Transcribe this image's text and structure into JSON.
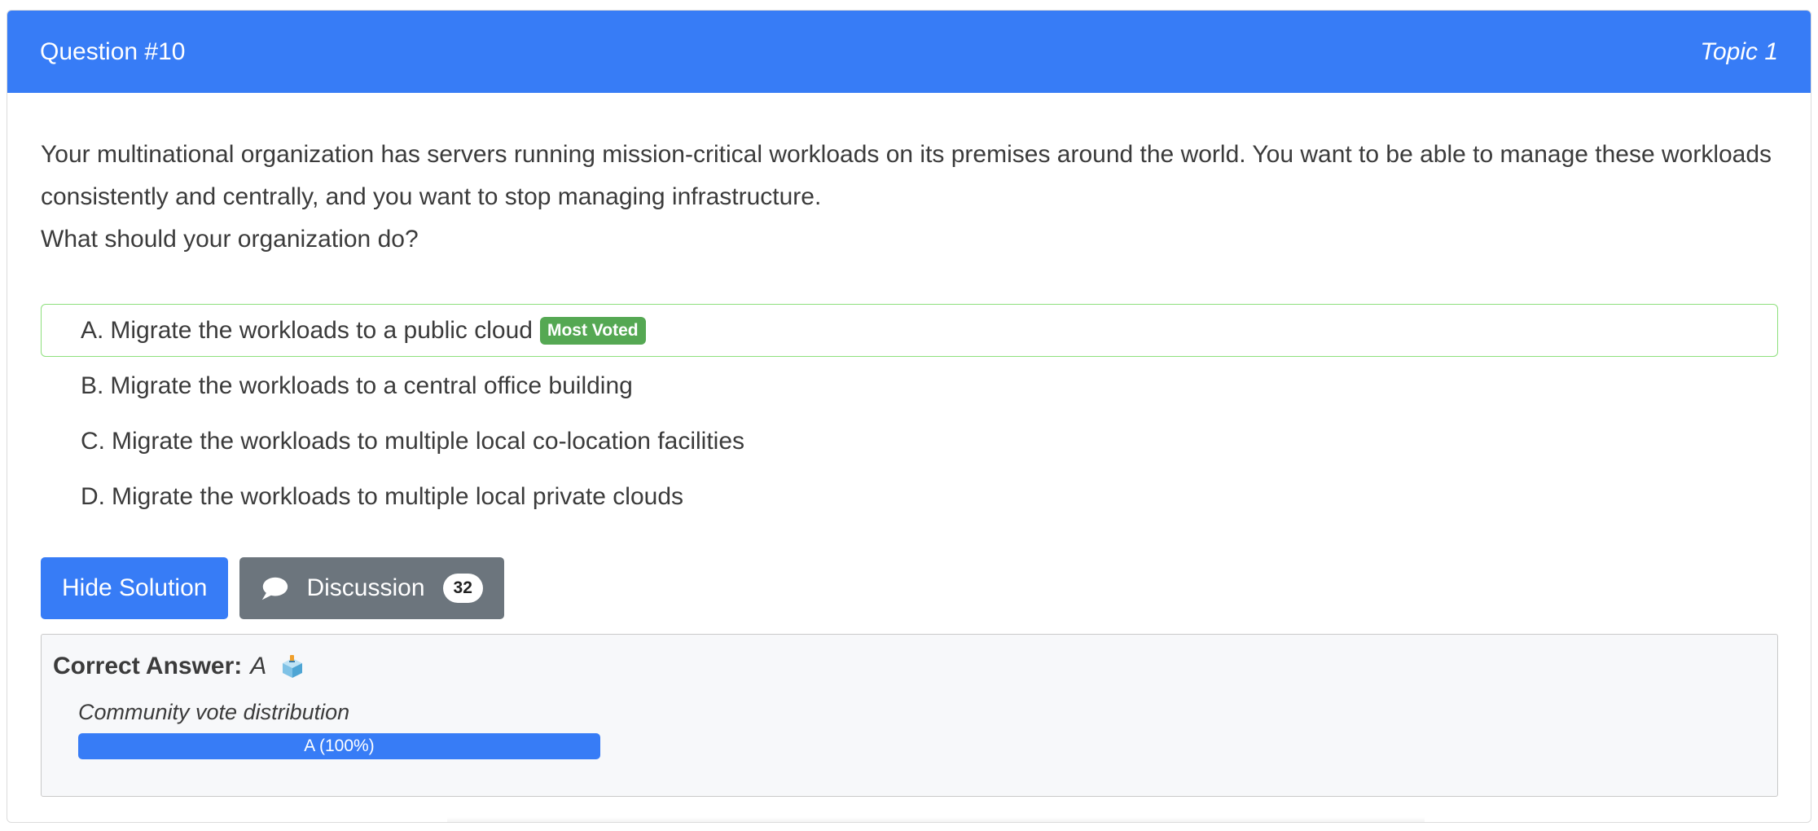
{
  "header": {
    "question_number": "Question #10",
    "topic": "Topic 1"
  },
  "question": {
    "line1": "Your multinational organization has servers running mission-critical workloads on its premises around the world. You want to be able to manage these workloads consistently and centrally, and you want to stop managing infrastructure.",
    "line2": "What should your organization do?"
  },
  "options": [
    {
      "letter": "A.",
      "text": "Migrate the workloads to a public cloud",
      "badge": "Most Voted"
    },
    {
      "letter": "B.",
      "text": "Migrate the workloads to a central office building"
    },
    {
      "letter": "C.",
      "text": "Migrate the workloads to multiple local co-location facilities"
    },
    {
      "letter": "D.",
      "text": "Migrate the workloads to multiple local private clouds"
    }
  ],
  "buttons": {
    "hide_solution": "Hide Solution",
    "discussion": "Discussion",
    "discussion_count": "32"
  },
  "answer": {
    "label": "Correct Answer:",
    "value": "A",
    "icon": "ballot-box-icon"
  },
  "vote": {
    "title": "Community vote distribution",
    "bar_label": "A (100%)",
    "fraction": 1.0
  },
  "colors": {
    "primary": "#377cf6",
    "secondary": "#6c757d",
    "most_voted": "#55a853",
    "voted_border": "#8ee07d"
  }
}
